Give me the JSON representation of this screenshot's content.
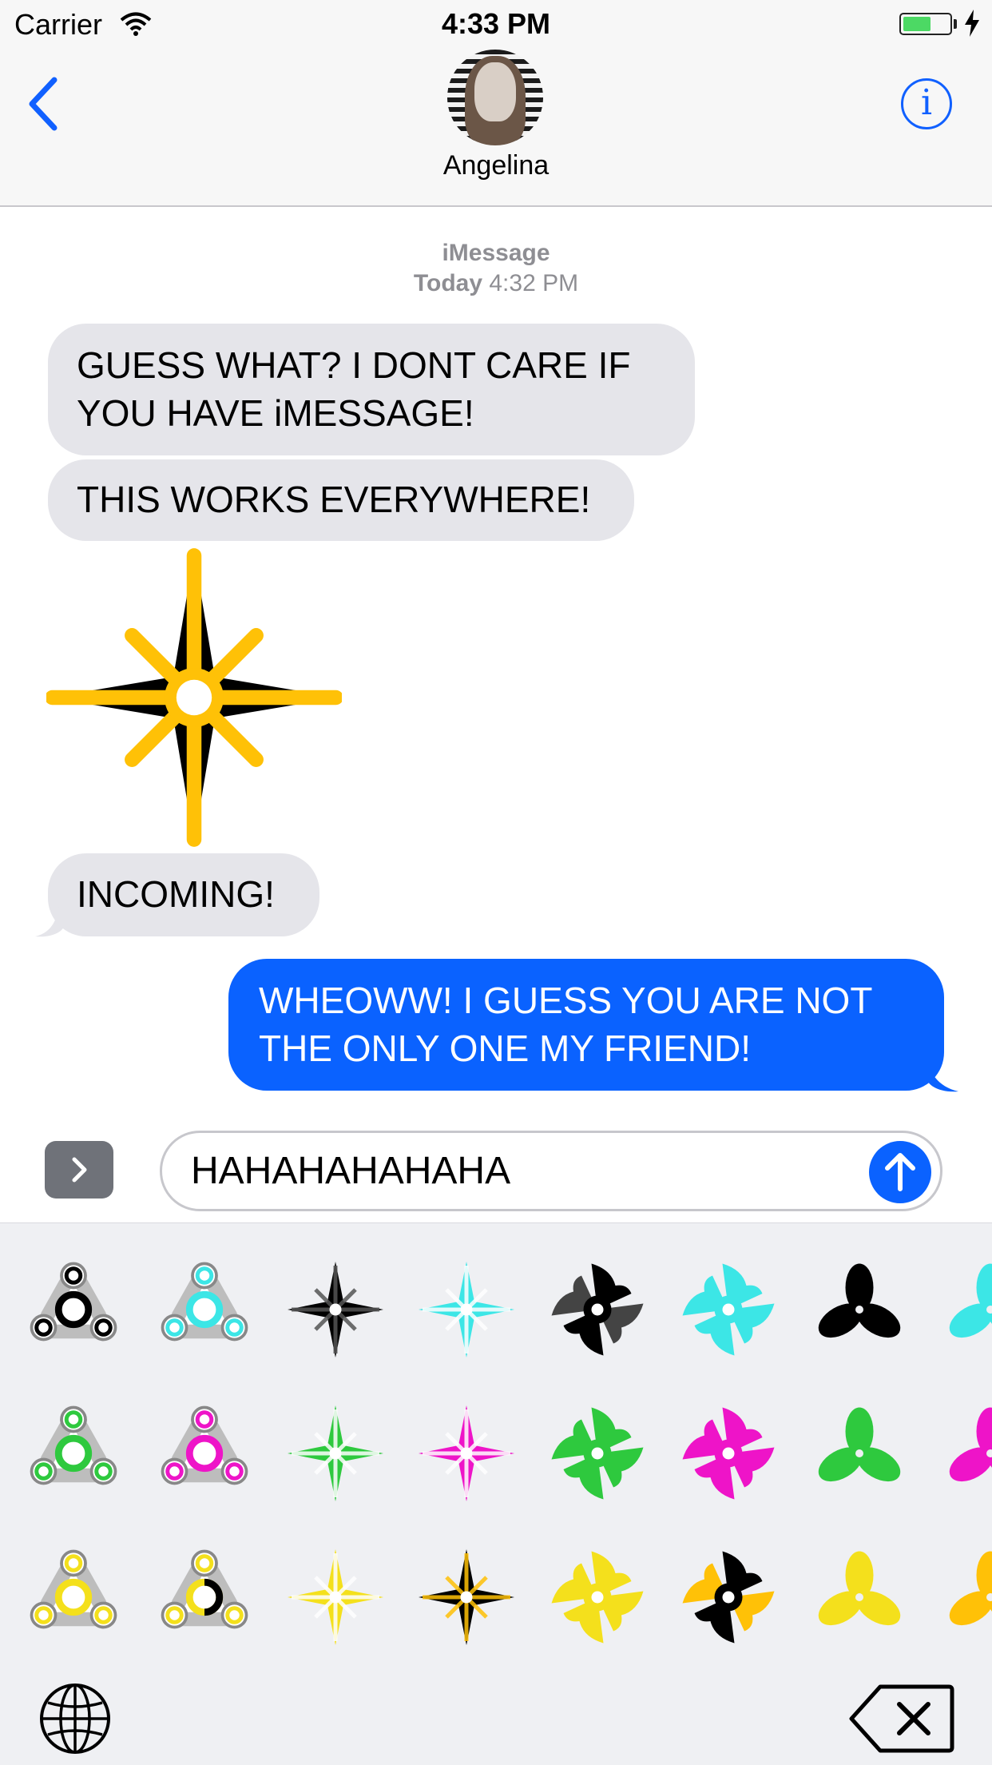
{
  "status_bar": {
    "carrier": "Carrier",
    "time": "4:33 PM",
    "battery_level": 0.6
  },
  "header": {
    "contact_name": "Angelina",
    "info_label": "i"
  },
  "thread": {
    "service": "iMessage",
    "date_label": "Today",
    "date_time": "4:32 PM",
    "messages": [
      {
        "from": "contact",
        "text_lines": [
          "GUESS WHAT? I DONT CARE IF",
          "YOU HAVE iMESSAGE!"
        ]
      },
      {
        "from": "contact",
        "text_lines": [
          "THIS WORKS EVERYWHERE!"
        ]
      },
      {
        "from": "contact",
        "sticker": "black-gold-ninja-star"
      },
      {
        "from": "contact",
        "text_lines": [
          "INCOMING!"
        ]
      },
      {
        "from": "me",
        "text_lines": [
          "WHEOWW! I GUESS YOU ARE NOT",
          "THE ONLY ONE MY FRIEND!"
        ]
      }
    ]
  },
  "composer": {
    "value": "HAHAHAHAHAHA"
  },
  "sticker_keyboard": {
    "rows": [
      [
        "black-spinner",
        "cyan-spinner",
        "black-star",
        "cyan-star",
        "black-pinwheel",
        "cyan-pinwheel",
        "black-trefoil",
        "cyan-trefoil"
      ],
      [
        "green-spinner",
        "magenta-spinner",
        "green-star",
        "magenta-star",
        "green-pinwheel",
        "magenta-pinwheel",
        "green-trefoil",
        "magenta-trefoil"
      ],
      [
        "yellow-spinner",
        "yellow-black-spinner",
        "yellow-star",
        "black-gold-star",
        "yellow-pinwheel",
        "black-gold-pinwheel",
        "yellow-trefoil",
        "gold-trefoil"
      ]
    ]
  },
  "colors": {
    "accent": "#0a62ff",
    "incoming_bubble": "#e5e5ea",
    "timestamp": "#8e8e93",
    "sticker_black": "#000000",
    "sticker_gold": "#ffc107",
    "sticker_cyan": "#3ce6e6",
    "sticker_green": "#2ec93e",
    "sticker_magenta": "#ee14c8",
    "sticker_yellow": "#f4e01c"
  }
}
